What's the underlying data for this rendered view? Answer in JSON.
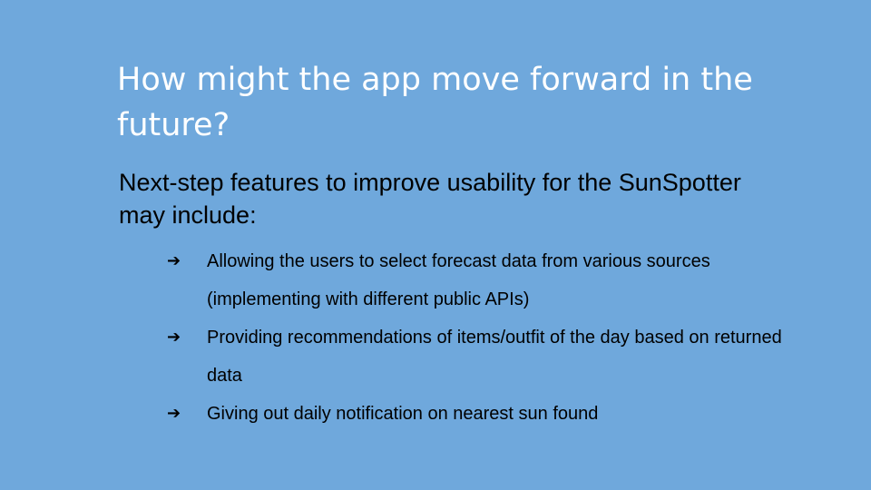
{
  "slide": {
    "background_color": "#6fa8dc",
    "title_color": "#ffffff",
    "text_color": "#000000",
    "title": "How might the app move forward in the future?",
    "intro": "Next-step features to improve usability for the SunSpotter may include:",
    "bullet_icon": "right-arrow-icon",
    "bullets": [
      {
        "text": "Allowing the users to select forecast data from various sources (implementing with different public APIs)"
      },
      {
        "text": "Providing recommendations of items/outfit of the day based on returned data"
      },
      {
        "text": "Giving out daily notification on nearest sun found"
      }
    ]
  }
}
